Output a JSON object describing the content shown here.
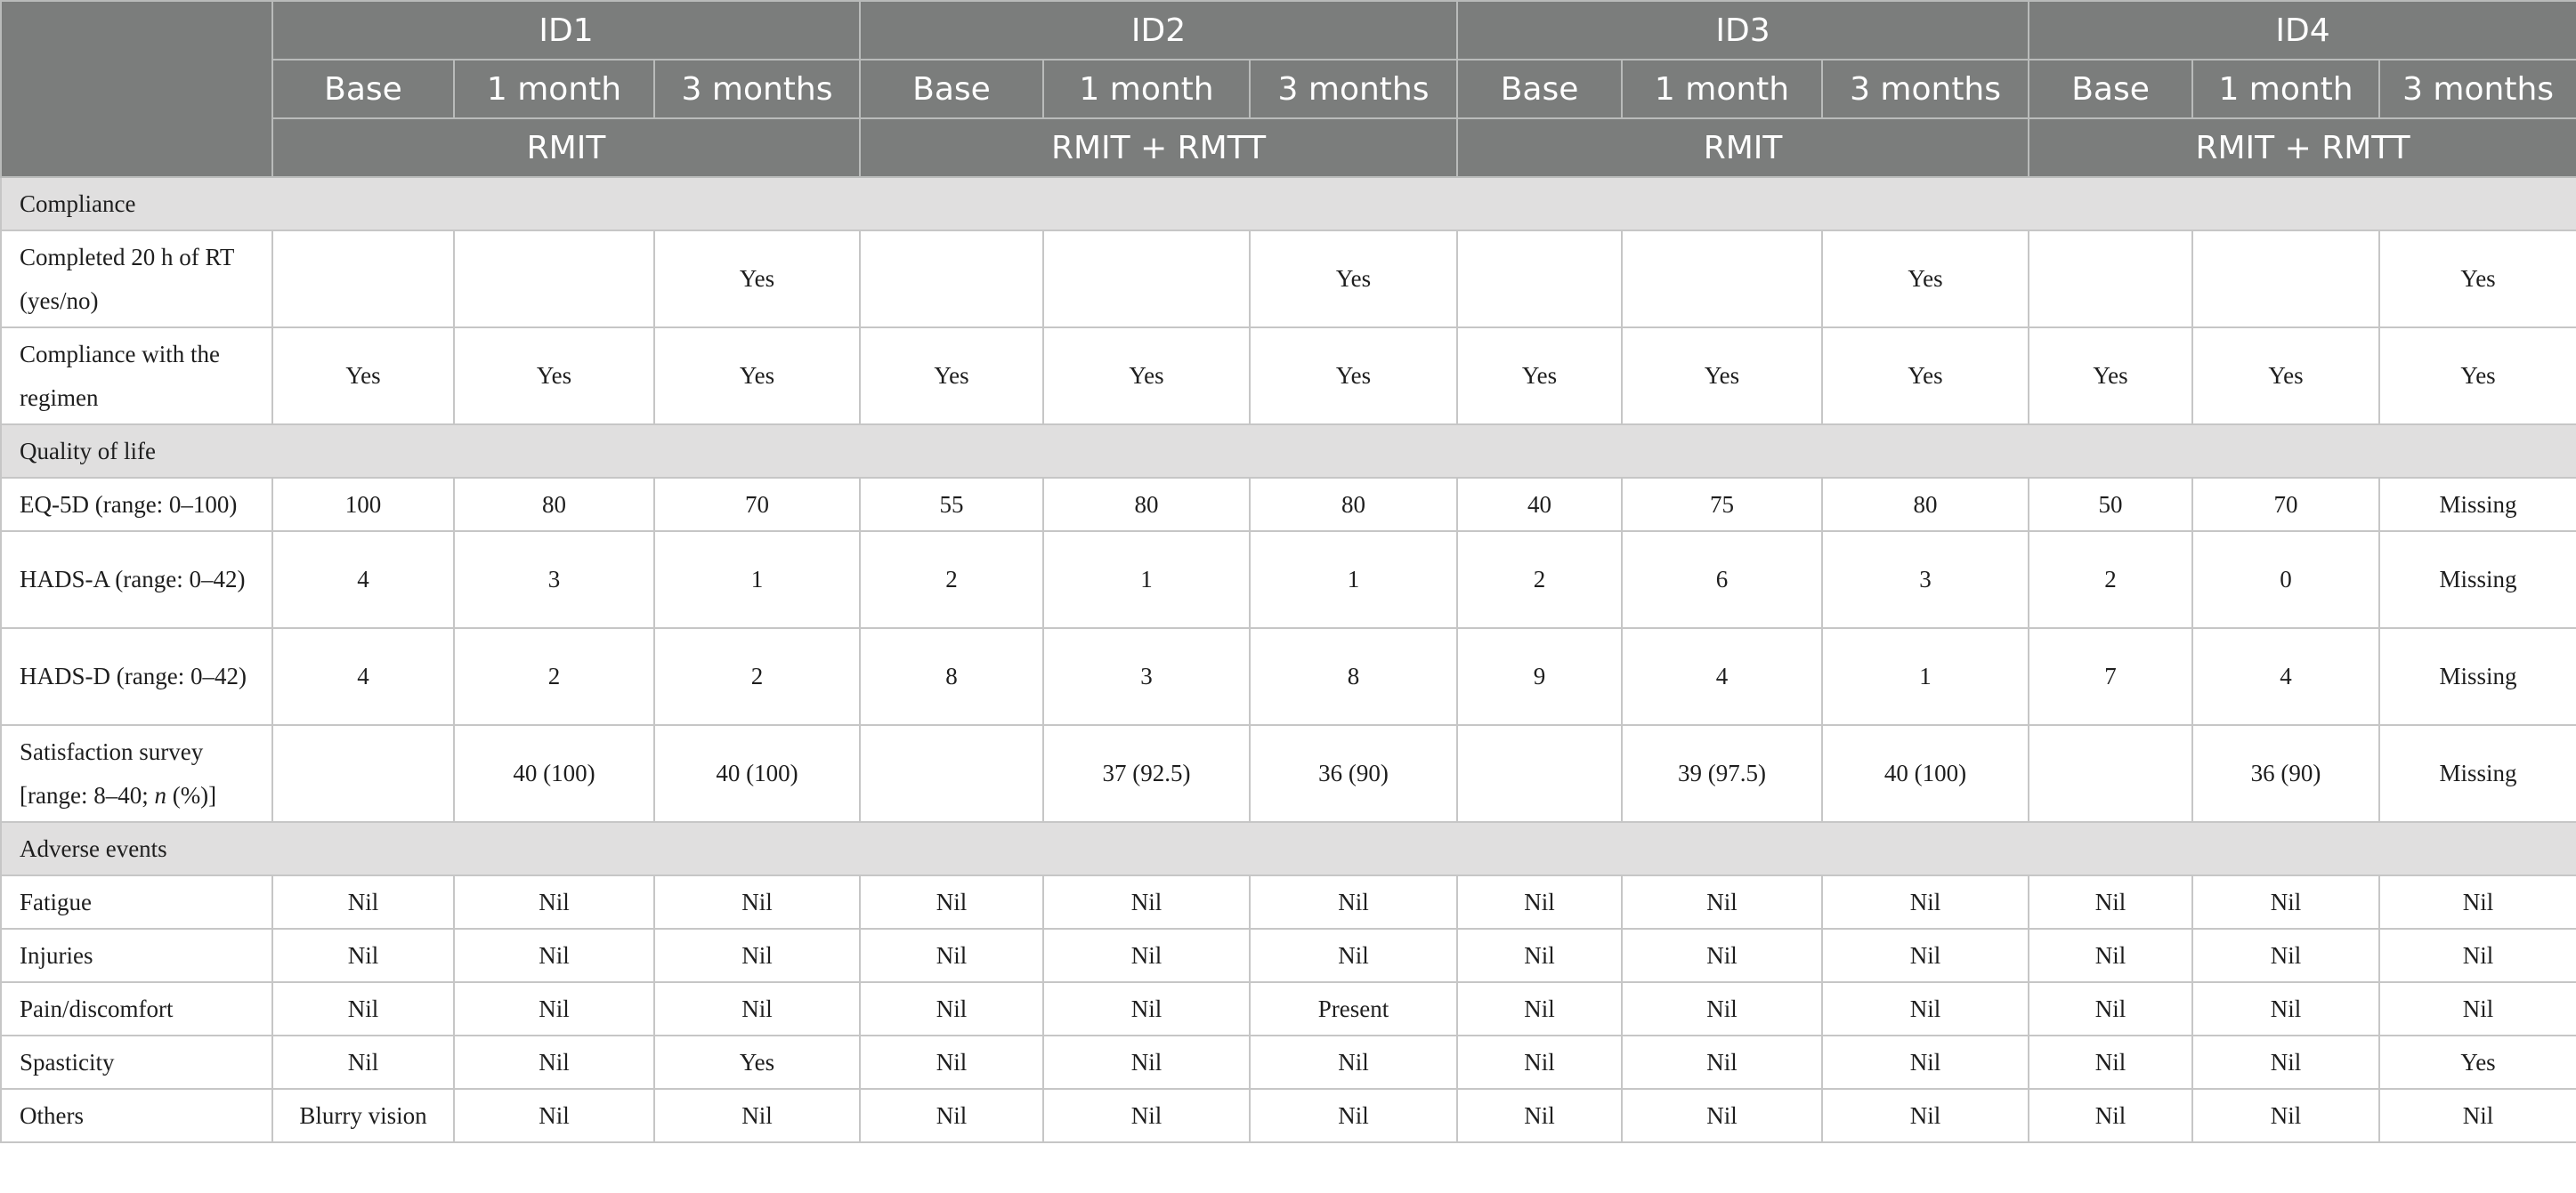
{
  "header": {
    "ids": [
      "ID1",
      "ID2",
      "ID3",
      "ID4"
    ],
    "timepoints": [
      "Base",
      "1 month",
      "3 months",
      "Base",
      "1 month",
      "3 months",
      "Base",
      "1 month",
      "3 months",
      "Base",
      "1 month",
      "3 months"
    ],
    "groups": [
      "RMIT",
      "RMIT + RMTT",
      "RMIT",
      "RMIT + RMTT"
    ]
  },
  "sections": {
    "compliance": "Compliance",
    "quality_of_life": "Quality of life",
    "adverse_events": "Adverse events"
  },
  "rows": {
    "completed_rt": {
      "label": "Completed 20 h of RT (yes/no)",
      "values": [
        "",
        "",
        "Yes",
        "",
        "",
        "Yes",
        "",
        "",
        "Yes",
        "",
        "",
        "Yes"
      ]
    },
    "compliance_regimen": {
      "label": "Compliance with the regimen",
      "values": [
        "Yes",
        "Yes",
        "Yes",
        "Yes",
        "Yes",
        "Yes",
        "Yes",
        "Yes",
        "Yes",
        "Yes",
        "Yes",
        "Yes"
      ]
    },
    "eq5d": {
      "label": "EQ-5D (range: 0–100)",
      "values": [
        "100",
        "80",
        "70",
        "55",
        "80",
        "80",
        "40",
        "75",
        "80",
        "50",
        "70",
        "Missing"
      ]
    },
    "hads_a": {
      "label": "HADS-A (range: 0–42)",
      "values": [
        "4",
        "3",
        "1",
        "2",
        "1",
        "1",
        "2",
        "6",
        "3",
        "2",
        "0",
        "Missing"
      ]
    },
    "hads_d": {
      "label": "HADS-D (range: 0–42)",
      "values": [
        "4",
        "2",
        "2",
        "8",
        "3",
        "8",
        "9",
        "4",
        "1",
        "7",
        "4",
        "Missing"
      ]
    },
    "satisfaction": {
      "label_pre": "Satisfaction survey [range: 8–40; ",
      "label_italic": "n",
      "label_post": " (%)]",
      "values": [
        "",
        "40 (100)",
        "40 (100)",
        "",
        "37 (92.5)",
        "36 (90)",
        "",
        "39 (97.5)",
        "40 (100)",
        "",
        "36 (90)",
        "Missing"
      ]
    },
    "fatigue": {
      "label": "Fatigue",
      "values": [
        "Nil",
        "Nil",
        "Nil",
        "Nil",
        "Nil",
        "Nil",
        "Nil",
        "Nil",
        "Nil",
        "Nil",
        "Nil",
        "Nil"
      ]
    },
    "injuries": {
      "label": "Injuries",
      "values": [
        "Nil",
        "Nil",
        "Nil",
        "Nil",
        "Nil",
        "Nil",
        "Nil",
        "Nil",
        "Nil",
        "Nil",
        "Nil",
        "Nil"
      ]
    },
    "pain": {
      "label": "Pain/discomfort",
      "values": [
        "Nil",
        "Nil",
        "Nil",
        "Nil",
        "Nil",
        "Present",
        "Nil",
        "Nil",
        "Nil",
        "Nil",
        "Nil",
        "Nil"
      ]
    },
    "spasticity": {
      "label": "Spasticity",
      "values": [
        "Nil",
        "Nil",
        "Yes",
        "Nil",
        "Nil",
        "Nil",
        "Nil",
        "Nil",
        "Nil",
        "Nil",
        "Nil",
        "Yes"
      ]
    },
    "others": {
      "label": "Others",
      "values": [
        "Blurry vision",
        "Nil",
        "Nil",
        "Nil",
        "Nil",
        "Nil",
        "Nil",
        "Nil",
        "Nil",
        "Nil",
        "Nil",
        "Nil"
      ]
    }
  }
}
